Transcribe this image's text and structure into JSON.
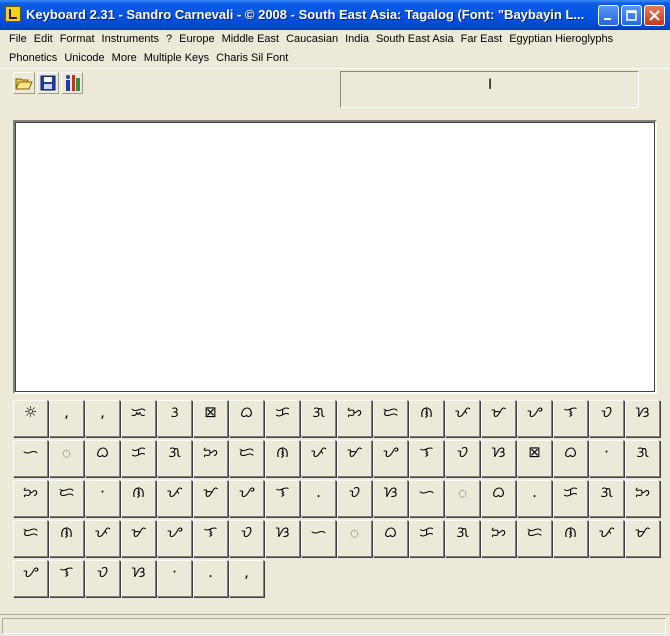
{
  "window": {
    "title": "Keyboard 2.31 - Sandro Carnevali - ©  2008 - South East Asia: Tagalog (Font: \"Baybayin L...",
    "minimize_label": "Minimize",
    "maximize_label": "Maximize",
    "close_label": "Close"
  },
  "menu": {
    "row1": [
      "File",
      "Edit",
      "Format",
      "Instruments",
      "?",
      "Europe",
      "Middle East",
      "Caucasian",
      "India",
      "South East Asia",
      "Far East",
      "Egyptian Hieroglyphs"
    ],
    "row2": [
      "Phonetics",
      "Unicode",
      "More",
      "Multiple Keys",
      "Charis Sil Font"
    ]
  },
  "toolbar": {
    "buttons": [
      {
        "name": "open-button",
        "icon": "folder-open-icon"
      },
      {
        "name": "save-button",
        "icon": "floppy-disk-icon"
      },
      {
        "name": "info-button",
        "icon": "info-icon"
      }
    ],
    "cursor_glyph": "I"
  },
  "keys": [
    [
      "☼",
      ",",
      ",",
      "ᜁ",
      "ᜂ",
      "⊠",
      "ᜊ",
      "ᜃ",
      "ᜄ",
      "ᜅ",
      "ᜇ",
      "ᜈ",
      "ᜉ",
      "ᜋ",
      "ᜌ",
      "ᜎ",
      "ᜏ",
      "ᜐ"
    ],
    [
      "ᜑ",
      "ᜀ",
      "ᜊ",
      "ᜃ",
      "ᜄ",
      "ᜅ",
      "ᜇ",
      "ᜈ",
      "ᜉ",
      "ᜋ",
      "ᜌ",
      "ᜎ",
      "ᜏ",
      "ᜐ",
      "⊠",
      "ᜊ",
      "·",
      "ᜄ"
    ],
    [
      "ᜅ",
      "ᜇ",
      "·",
      "ᜈ",
      "ᜉ",
      "ᜋ",
      "ᜌ",
      "ᜎ",
      ".",
      "ᜏ",
      "ᜐ",
      "ᜑ",
      "ᜀ",
      "ᜊ",
      ".",
      "ᜃ",
      "ᜄ",
      "ᜅ"
    ],
    [
      "ᜇ",
      "ᜈ",
      "ᜉ",
      "ᜋ",
      "ᜌ",
      "ᜎ",
      "ᜏ",
      "ᜐ",
      "ᜑ",
      "ᜀ",
      "ᜊ",
      "ᜃ",
      "ᜄ",
      "ᜅ",
      "ᜇ",
      "ᜈ",
      "ᜉ",
      "ᜋ"
    ],
    [
      "ᜌ",
      "ᜎ",
      "ᜏ",
      "ᜐ",
      "·",
      ".",
      ","
    ]
  ],
  "colors": {
    "titlebar": "#0554e3",
    "chrome": "#ece9d8",
    "text_area": "#ffffff"
  }
}
